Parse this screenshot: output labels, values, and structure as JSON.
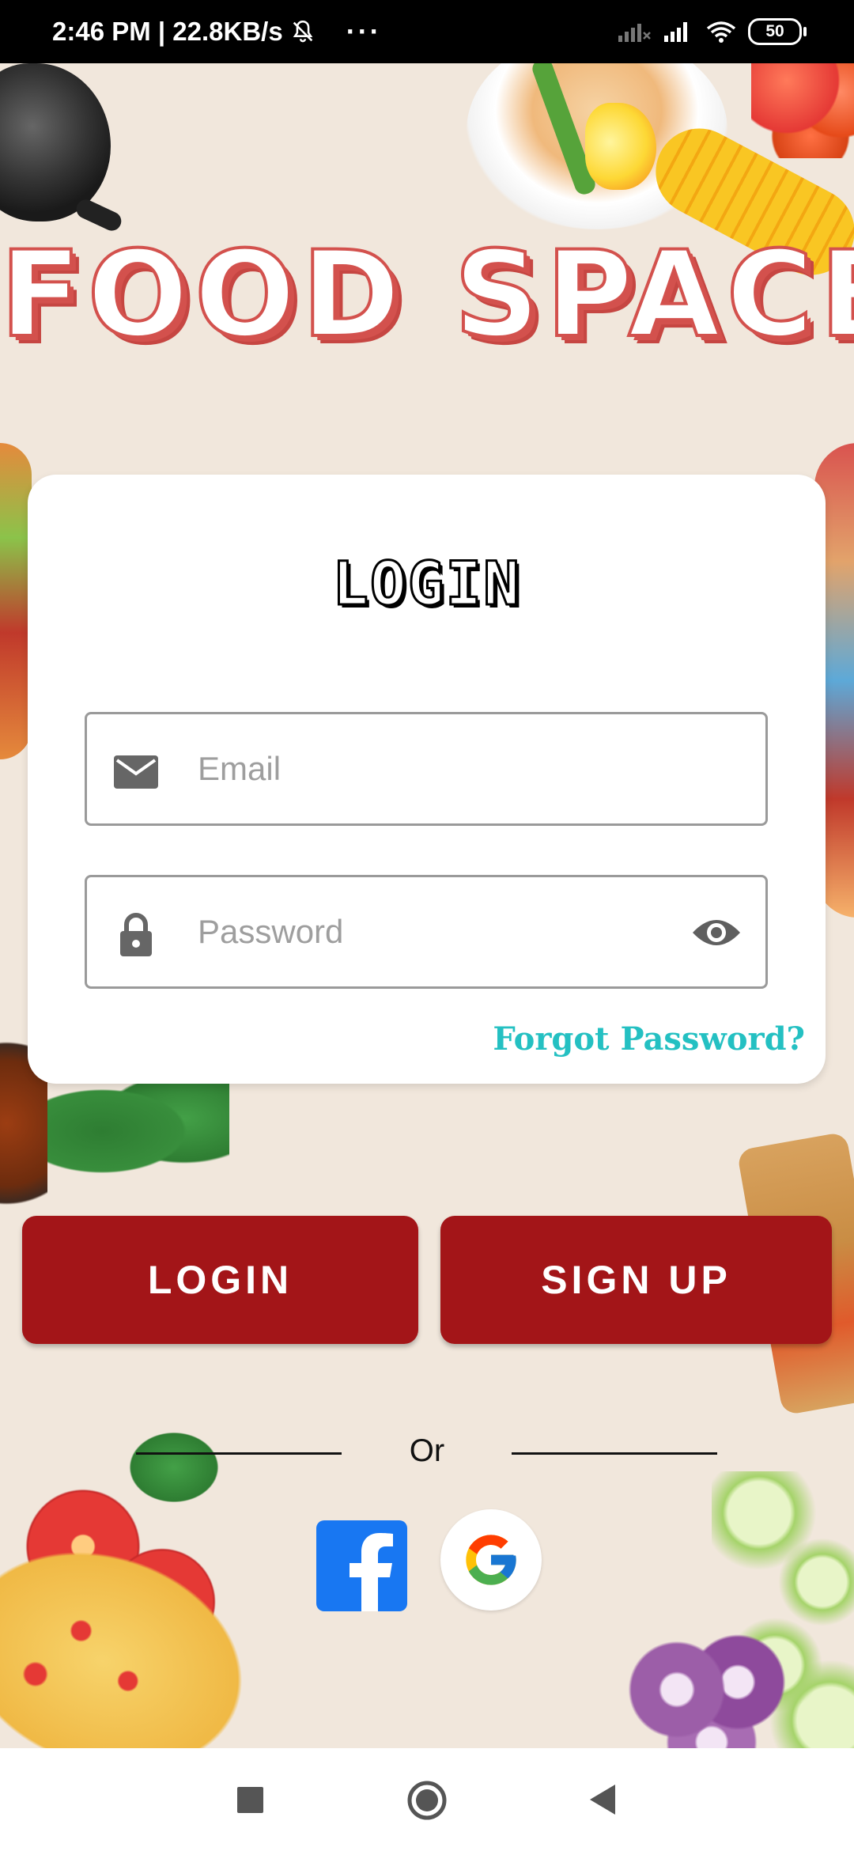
{
  "status_bar": {
    "time_speed": "2:46 PM | 22.8KB/s",
    "more": "···",
    "battery": "50"
  },
  "app": {
    "title": "FOOD SPACE"
  },
  "login_card": {
    "title": "LOGIN",
    "email": {
      "placeholder": "Email",
      "value": ""
    },
    "password": {
      "placeholder": "Password",
      "value": ""
    },
    "forgot_password": "Forgot Password?"
  },
  "actions": {
    "login_label": "LOGIN",
    "signup_label": "SIGN UP"
  },
  "divider": {
    "text": "Or"
  },
  "social": {
    "facebook_icon": "facebook-icon",
    "google_icon": "google-icon"
  },
  "icons": {
    "email": "envelope-icon",
    "password": "lock-icon",
    "toggle_visibility": "eye-icon",
    "notification": "bell-muted-icon",
    "signal": "signal-icon",
    "wifi": "wifi-icon",
    "nav_recents": "square-icon",
    "nav_home": "circle-icon",
    "nav_back": "triangle-back-icon"
  },
  "colors": {
    "title_red": "#d3514d",
    "button_red": "#a31518",
    "link_teal": "#24c0c2",
    "background": "#f1e7dc",
    "card": "#ffffff",
    "facebook_blue": "#1877f2"
  }
}
